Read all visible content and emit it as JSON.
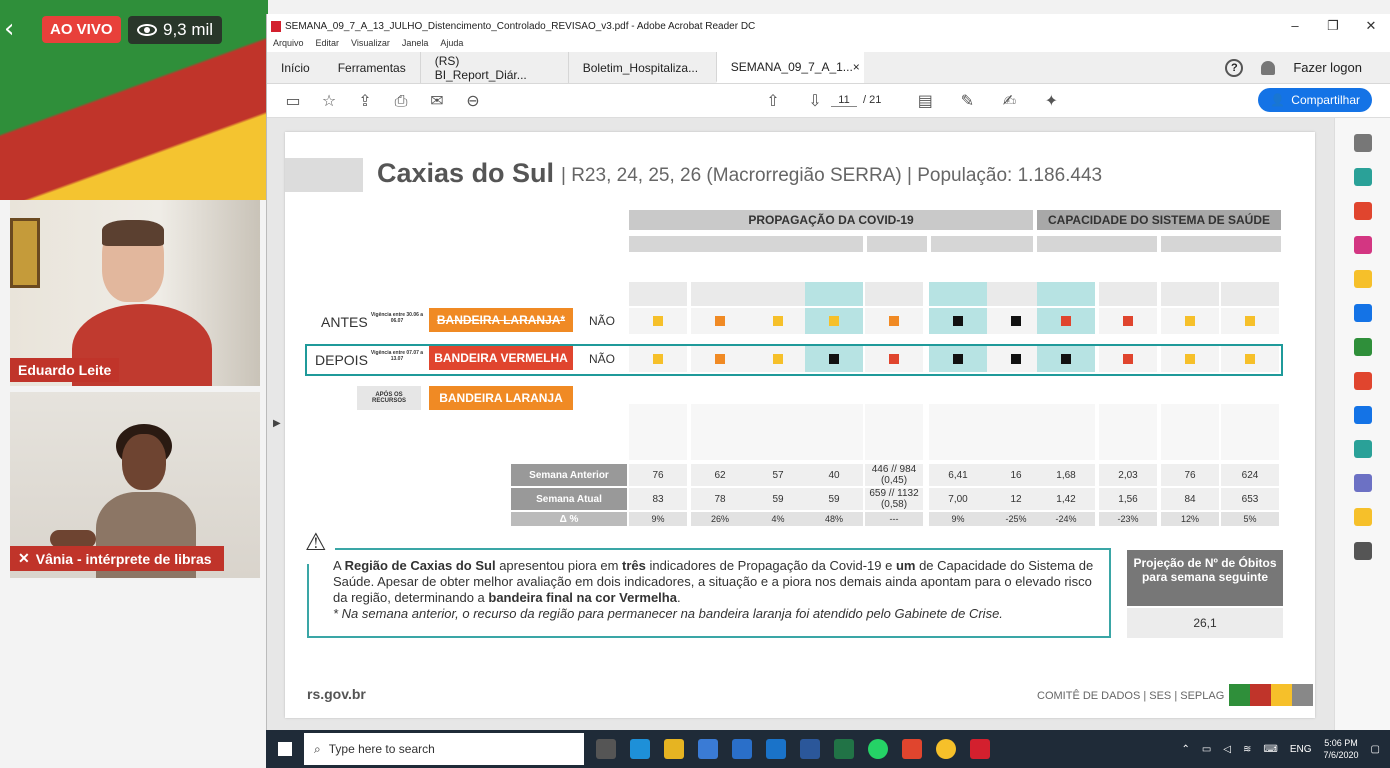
{
  "stream": {
    "live_label": "AO VIVO",
    "viewers": "9,3 mil",
    "speaker1_name": "Eduardo Leite",
    "speaker2_name": "Vânia - intérprete de libras"
  },
  "window": {
    "title": "SEMANA_09_7_A_13_JULHO_Distencimento_Controlado_REVISAO_v3.pdf - Adobe Acrobat Reader DC",
    "menu": [
      "Arquivo",
      "Editar",
      "Visualizar",
      "Janela",
      "Ajuda"
    ],
    "tabs": [
      "Início",
      "Ferramentas"
    ],
    "doc_tabs": [
      "(RS) BI_Report_Diár...",
      "Boletim_Hospitaliza...",
      "SEMANA_09_7_A_1..."
    ],
    "login": "Fazer logon",
    "page_current": "11",
    "page_total": "/ 21",
    "share_label": "Compartilhar"
  },
  "page": {
    "city": "Caxias do Sul",
    "subtitle": "| R23, 24, 25, 26 (Macrorregião SERRA)  |  População: 1.186.443",
    "header_prop": "PROPAGAÇÃO DA COVID-19",
    "header_cap": "CAPACIDADE DO SISTEMA DE SAÚDE",
    "antes": "ANTES",
    "antes_vig": "Vigência entre 30.06 a 06.07",
    "antes_flag": "BANDEIRA LARANJA*",
    "depois": "DEPOIS",
    "depois_vig": "Vigência entre 07.07 a 13.07",
    "depois_flag": "BANDEIRA VERMELHA",
    "nao": "NÃO",
    "apos": "APÓS OS RECURSOS",
    "apos_flag": "BANDEIRA LARANJA",
    "row_prev": "Semana Anterior",
    "row_cur": "Semana Atual",
    "row_delta": "Δ %",
    "prev_values": [
      "76",
      "62",
      "57",
      "40",
      "446 // 984 (0,45)",
      "6,41",
      "16",
      "1,68",
      "2,03",
      "76",
      "624"
    ],
    "cur_values": [
      "83",
      "78",
      "59",
      "59",
      "659 // 1132 (0,58)",
      "7,00",
      "12",
      "1,42",
      "1,56",
      "84",
      "653"
    ],
    "delta_values": [
      "9%",
      "26%",
      "4%",
      "48%",
      "---",
      "9%",
      "-25%",
      "-24%",
      "-23%",
      "12%",
      "5%"
    ],
    "antes_colors": [
      "y",
      "o",
      "y",
      "y",
      "o",
      "k",
      "k",
      "r",
      "r",
      "y",
      "y"
    ],
    "depois_colors": [
      "y",
      "o",
      "y",
      "k",
      "r",
      "k",
      "k",
      "k",
      "r",
      "y",
      "y"
    ],
    "note_p1": "A ",
    "note_b1": "Região de Caxias do Sul",
    "note_p2": " apresentou piora em ",
    "note_b2": "três",
    "note_p3": " indicadores de Propagação da Covid-19 e ",
    "note_b3": "um",
    "note_p4": " de Capacidade do Sistema de Saúde. Apesar de obter melhor avaliação em dois indicadores, a situação e a piora nos demais ainda apontam para o elevado risco da região, determinando a ",
    "note_b4": "bandeira final na cor Vermelha",
    "note_p5": ".",
    "note_italic": "* Na semana anterior, o recurso da região para permanecer na bandeira laranja foi atendido pelo Gabinete de Crise.",
    "proj_title": "Projeção de Nº de Óbitos para semana seguinte",
    "proj_value": "26,1",
    "footer_url": "rs.gov.br",
    "footer_right": "COMITÊ DE DADOS |  SES  |  SEPLAG"
  },
  "taskbar": {
    "search_placeholder": "Type here to search",
    "lang": "ENG",
    "time": "5:06 PM",
    "date": "7/6/2020"
  }
}
